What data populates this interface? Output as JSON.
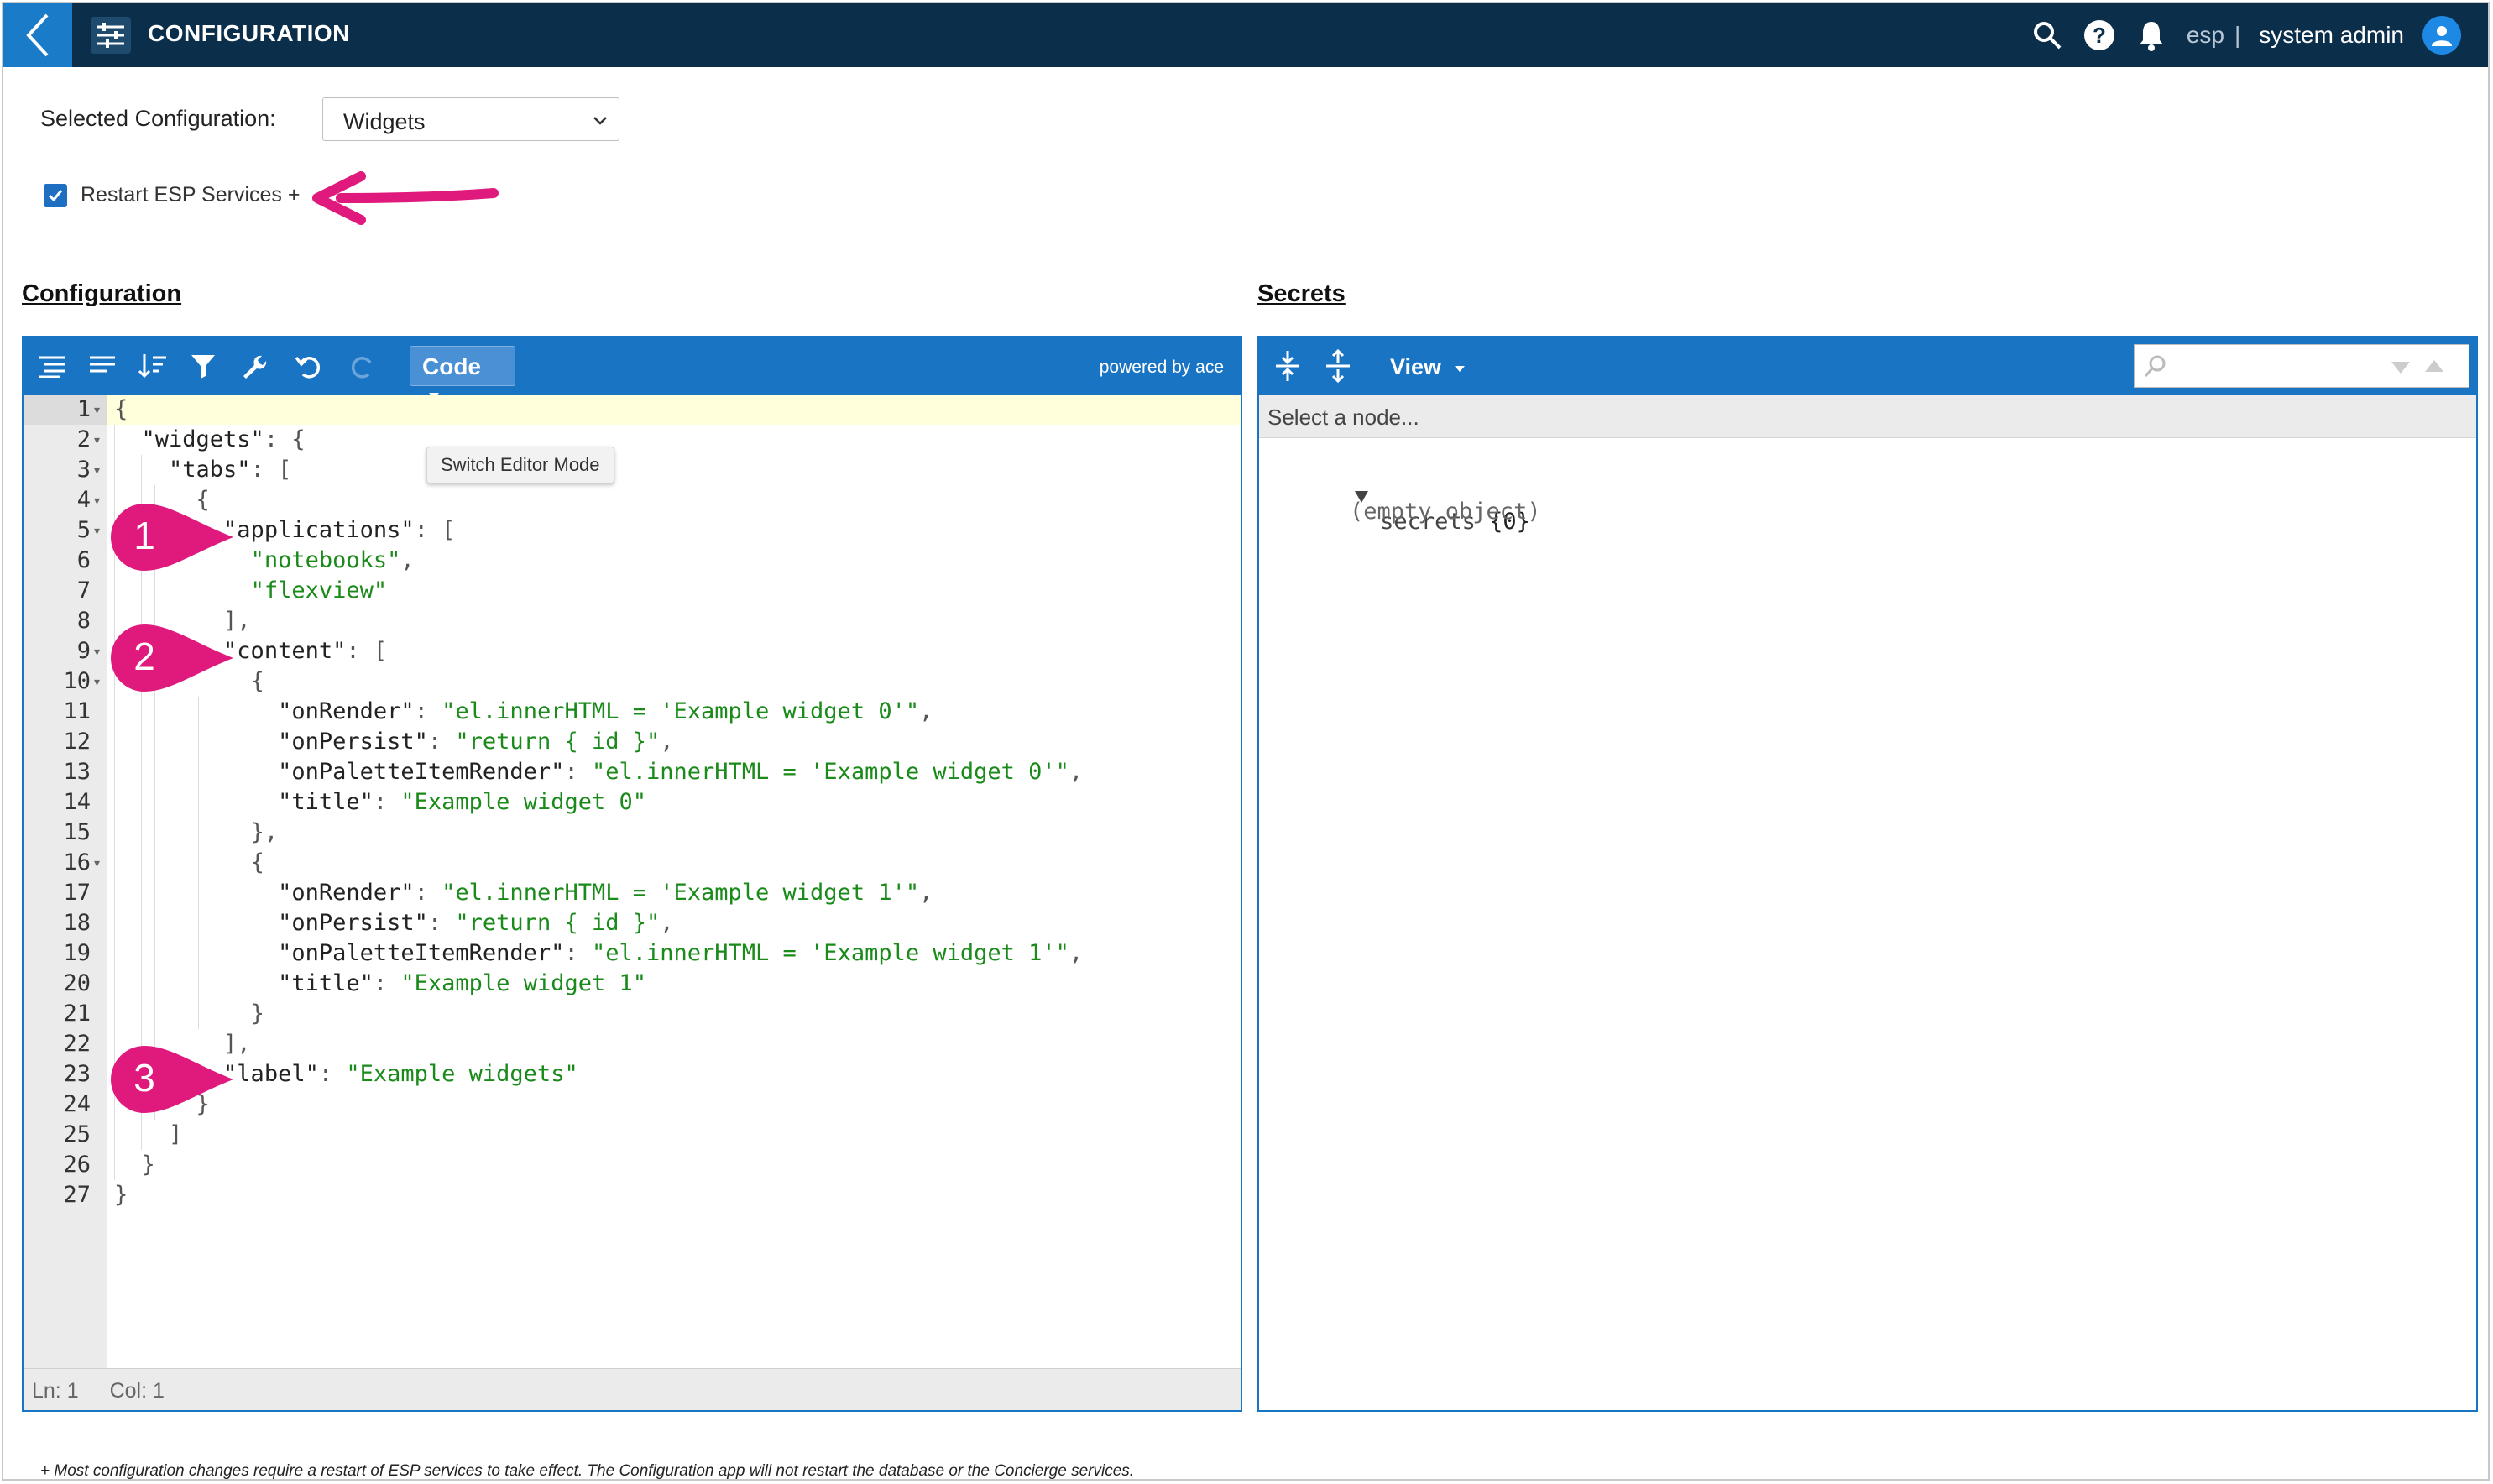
{
  "header": {
    "title": "CONFIGURATION",
    "tenant": "esp",
    "separator": "|",
    "user": "system admin"
  },
  "selection": {
    "label": "Selected Configuration:",
    "value": "Widgets"
  },
  "restart": {
    "label": "Restart ESP Services +",
    "checked": true
  },
  "sections": {
    "configuration": "Configuration",
    "secrets": "Secrets"
  },
  "editor": {
    "mode_label": "Code",
    "powered_by": "powered by ace",
    "tooltip": "Switch Editor Mode",
    "status": {
      "ln": "Ln: 1",
      "col": "Col: 1"
    },
    "markers": [
      "1",
      "2",
      "3"
    ],
    "line_numbers": [
      "1",
      "2",
      "3",
      "4",
      "5",
      "6",
      "7",
      "8",
      "9",
      "10",
      "11",
      "12",
      "13",
      "14",
      "15",
      "16",
      "17",
      "18",
      "19",
      "20",
      "21",
      "22",
      "23",
      "24",
      "25",
      "26",
      "27"
    ]
  },
  "secrets": {
    "view_label": "View",
    "nav_placeholder": "Select a node...",
    "tree_key": "secrets",
    "tree_count": "{0}",
    "tree_empty": "(empty object)"
  },
  "footer": {
    "note": "+ Most configuration changes require a restart of ESP services to take effect. The Configuration app will not restart the database or the Concierge services."
  },
  "colors": {
    "header_bg": "#0b2e4a",
    "accent": "#1a74c4",
    "marker": "#e0197d",
    "string": "#1a8a1a"
  }
}
